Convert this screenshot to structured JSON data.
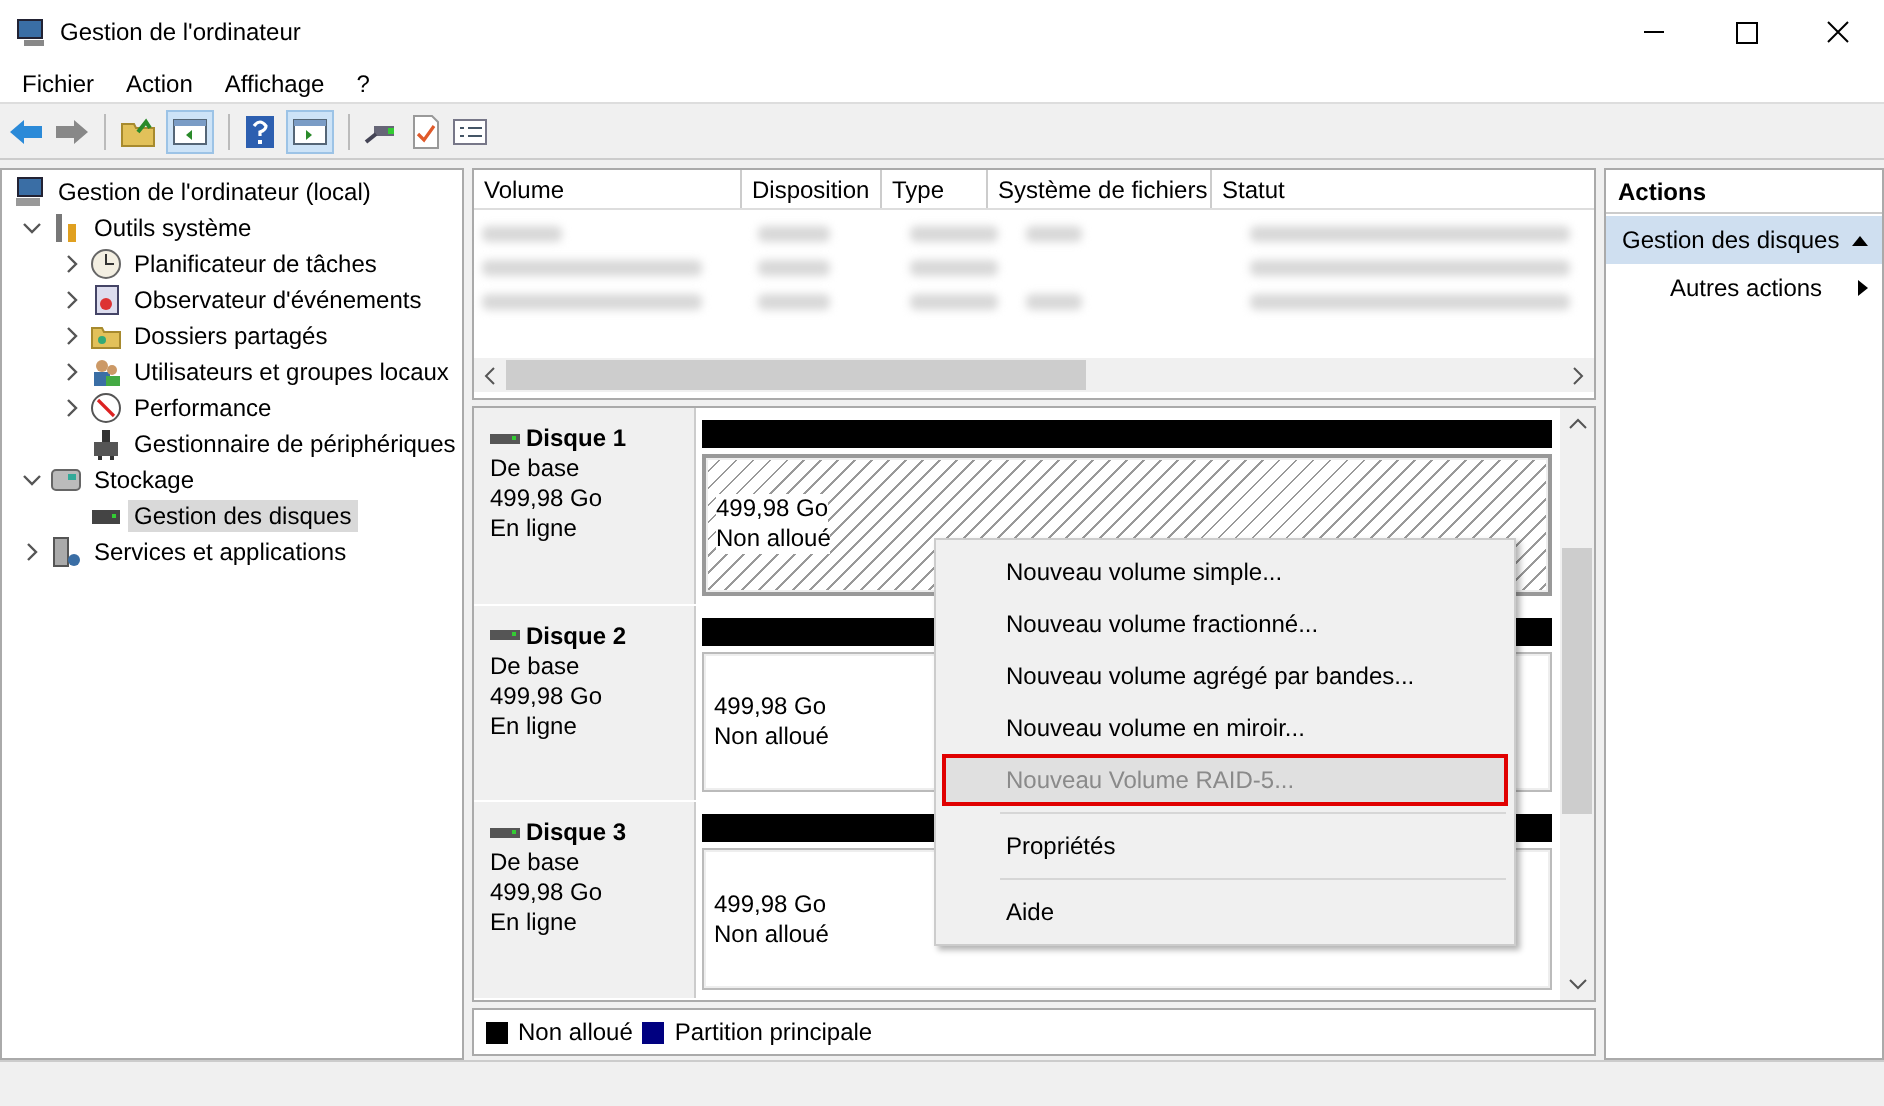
{
  "window": {
    "title": "Gestion de l'ordinateur"
  },
  "menu": [
    "Fichier",
    "Action",
    "Affichage",
    "?"
  ],
  "tree": [
    {
      "label": "Gestion de l'ordinateur (local)",
      "selected": false,
      "children": [
        {
          "label": "Outils système",
          "expanded": true,
          "selected": false,
          "children": [
            {
              "label": "Planificateur de tâches",
              "expanded": false,
              "selected": false
            },
            {
              "label": "Observateur d'événements",
              "expanded": false,
              "selected": false
            },
            {
              "label": "Dossiers partagés",
              "expanded": false,
              "selected": false
            },
            {
              "label": "Utilisateurs et groupes locaux",
              "expanded": false,
              "selected": false
            },
            {
              "label": "Performance",
              "expanded": false,
              "selected": false
            },
            {
              "label": "Gestionnaire de périphériques",
              "selected": false
            }
          ]
        },
        {
          "label": "Stockage",
          "expanded": true,
          "selected": false,
          "children": [
            {
              "label": "Gestion des disques",
              "selected": true
            }
          ]
        },
        {
          "label": "Services et applications",
          "expanded": false,
          "selected": false
        }
      ]
    }
  ],
  "volume_table": {
    "columns": [
      "Volume",
      "Disposition",
      "Type",
      "Système de fichiers",
      "Statut"
    ]
  },
  "disks": [
    {
      "name": "Disque 1",
      "type": "De base",
      "size": "499,98 Go",
      "status": "En ligne",
      "partition": {
        "size": "499,98 Go",
        "state": "Non alloué",
        "selected": true
      }
    },
    {
      "name": "Disque 2",
      "type": "De base",
      "size": "499,98 Go",
      "status": "En ligne",
      "partition": {
        "size": "499,98 Go",
        "state": "Non alloué",
        "selected": false
      }
    },
    {
      "name": "Disque 3",
      "type": "De base",
      "size": "499,98 Go",
      "status": "En ligne",
      "partition": {
        "size": "499,98 Go",
        "state": "Non alloué",
        "selected": false
      }
    }
  ],
  "legend": [
    {
      "label": "Non alloué",
      "color": "#000000"
    },
    {
      "label": "Partition principale",
      "color": "#000080"
    }
  ],
  "context_menu": [
    {
      "kind": "item",
      "label": "Nouveau volume simple...",
      "disabled": false,
      "highlighted": false
    },
    {
      "kind": "item",
      "label": "Nouveau volume fractionné...",
      "disabled": false,
      "highlighted": false
    },
    {
      "kind": "item",
      "label": "Nouveau volume agrégé par bandes...",
      "disabled": false,
      "highlighted": false
    },
    {
      "kind": "item",
      "label": "Nouveau volume en miroir...",
      "disabled": false,
      "highlighted": false
    },
    {
      "kind": "item",
      "label": "Nouveau Volume RAID-5...",
      "disabled": true,
      "highlighted": true
    },
    {
      "kind": "separator"
    },
    {
      "kind": "item",
      "label": "Propriétés",
      "disabled": false,
      "highlighted": false
    },
    {
      "kind": "separator"
    },
    {
      "kind": "item",
      "label": "Aide",
      "disabled": false,
      "highlighted": false
    }
  ],
  "actions": {
    "title": "Actions",
    "section": {
      "label": "Gestion des disques",
      "expanded": true
    },
    "items": [
      {
        "label": "Autres actions"
      }
    ]
  }
}
